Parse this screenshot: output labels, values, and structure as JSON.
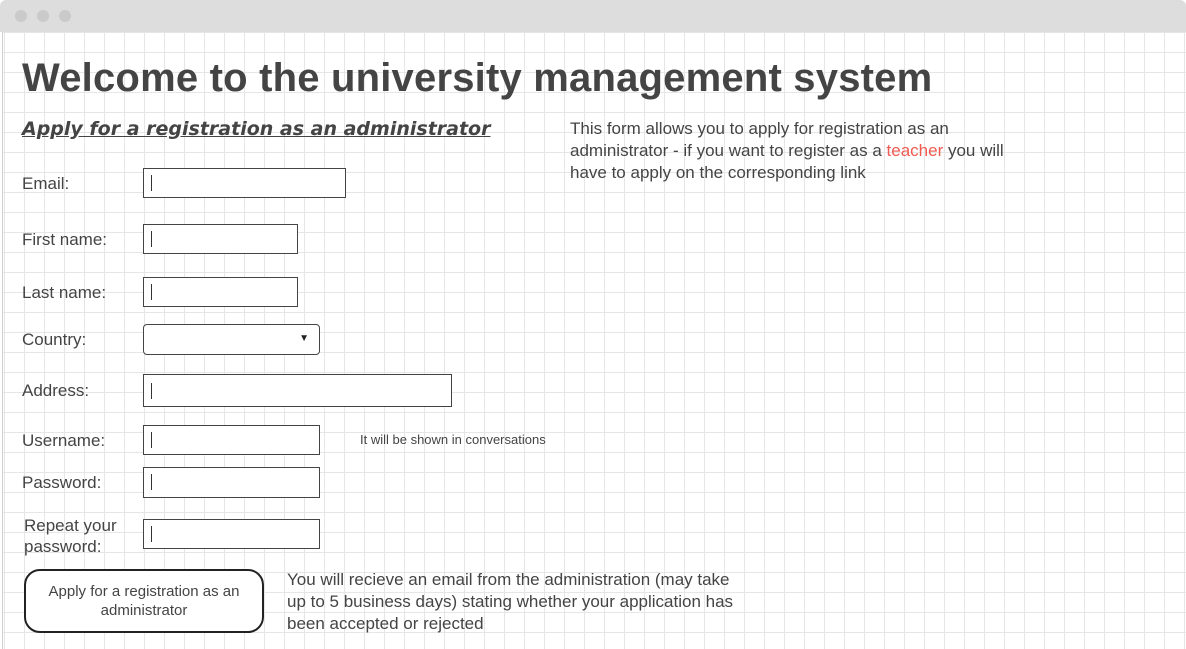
{
  "window": {
    "controls": [
      "close",
      "minimize",
      "maximize"
    ]
  },
  "page": {
    "title": "Welcome to the university management system",
    "subtitle": "Apply for a registration as an administrator",
    "info": {
      "before": "This form allows you to apply for registration as an administrator - if you want to register as a ",
      "link": "teacher",
      "after": " you will have to apply on the corresponding link",
      "link_color": "#f05a50"
    }
  },
  "form": {
    "email_label": "Email:",
    "first_name_label": "First name:",
    "last_name_label": "Last name:",
    "country_label": "Country:",
    "country_value": "",
    "address_label": "Address:",
    "username_label": "Username:",
    "username_hint": "It will be shown in conversations",
    "password_label": "Password:",
    "repeat_password_label_line1": "Repeat your",
    "repeat_password_label_line2": "password:",
    "submit_label": "Apply for a registration as an administrator",
    "note": "You will recieve an email from the administration (may take up to 5 business days) stating whether your application has been accepted or rejected"
  }
}
